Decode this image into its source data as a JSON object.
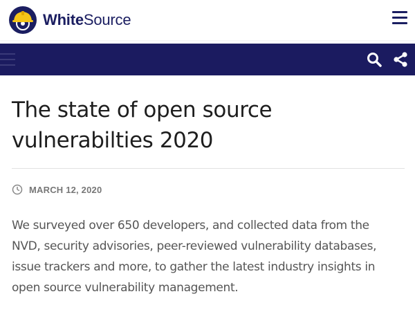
{
  "brand": {
    "name_bold": "White",
    "name_regular": "Source",
    "logo_icon": "hardhat-gear-icon",
    "color": "#1b1e61",
    "accent": "#f5c518"
  },
  "header": {
    "menu_icon": "hamburger-menu-icon"
  },
  "navbar": {
    "background": "#1b1b60",
    "search_icon": "search-icon",
    "share_icon": "share-icon"
  },
  "article": {
    "title_line1": "The state of open source",
    "title_line2": "vulnerabilties 2020",
    "date_icon": "clock-icon",
    "date": "MARCH 12, 2020",
    "summary_lines": [
      "We surveyed over 650 developers, and collected data from the",
      "NVD, security advisories, peer-reviewed vulnerability databases,",
      "issue trackers and more, to gather the latest industry insights in",
      "open source vulnerability management."
    ]
  }
}
